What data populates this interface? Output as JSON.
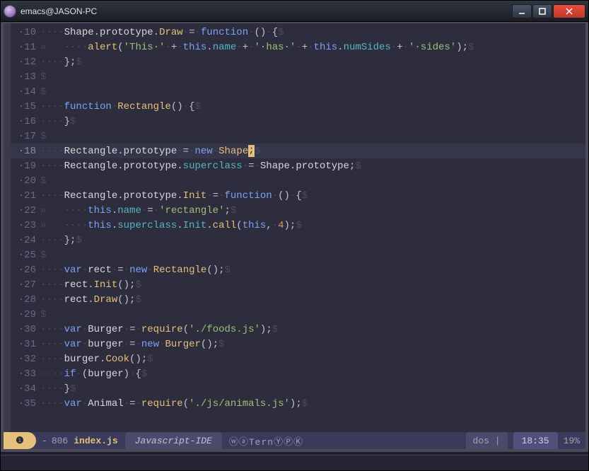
{
  "window": {
    "title": "emacs@JASON-PC"
  },
  "lines": [
    {
      "n": "10",
      "tokens": [
        {
          "c": "ws",
          "t": "····"
        },
        {
          "c": "id",
          "t": "Shape"
        },
        {
          "c": "punc",
          "t": "."
        },
        {
          "c": "id",
          "t": "prototype"
        },
        {
          "c": "punc",
          "t": "."
        },
        {
          "c": "fn",
          "t": "Draw"
        },
        {
          "c": "ws",
          "t": "·"
        },
        {
          "c": "op",
          "t": "="
        },
        {
          "c": "ws",
          "t": "·"
        },
        {
          "c": "kw",
          "t": "function"
        },
        {
          "c": "ws",
          "t": "·"
        },
        {
          "c": "punc",
          "t": "()"
        },
        {
          "c": "ws",
          "t": "·"
        },
        {
          "c": "punc",
          "t": "{"
        },
        {
          "c": "eol",
          "t": "$"
        }
      ]
    },
    {
      "n": "11",
      "tokens": [
        {
          "c": "tab",
          "t": "»   "
        },
        {
          "c": "ws",
          "t": "····"
        },
        {
          "c": "fn",
          "t": "alert"
        },
        {
          "c": "punc",
          "t": "("
        },
        {
          "c": "str",
          "t": "'This·'"
        },
        {
          "c": "ws",
          "t": "·"
        },
        {
          "c": "op",
          "t": "+"
        },
        {
          "c": "ws",
          "t": "·"
        },
        {
          "c": "kw",
          "t": "this"
        },
        {
          "c": "punc",
          "t": "."
        },
        {
          "c": "prop",
          "t": "name"
        },
        {
          "c": "ws",
          "t": "·"
        },
        {
          "c": "op",
          "t": "+"
        },
        {
          "c": "ws",
          "t": "·"
        },
        {
          "c": "str",
          "t": "'·has·'"
        },
        {
          "c": "ws",
          "t": "·"
        },
        {
          "c": "op",
          "t": "+"
        },
        {
          "c": "ws",
          "t": "·"
        },
        {
          "c": "kw",
          "t": "this"
        },
        {
          "c": "punc",
          "t": "."
        },
        {
          "c": "prop",
          "t": "numSides"
        },
        {
          "c": "ws",
          "t": "·"
        },
        {
          "c": "op",
          "t": "+"
        },
        {
          "c": "ws",
          "t": "·"
        },
        {
          "c": "str",
          "t": "'·sides'"
        },
        {
          "c": "punc",
          "t": ");"
        },
        {
          "c": "eol",
          "t": "$"
        }
      ]
    },
    {
      "n": "12",
      "tokens": [
        {
          "c": "ws",
          "t": "····"
        },
        {
          "c": "punc",
          "t": "};"
        },
        {
          "c": "eol",
          "t": "$"
        }
      ]
    },
    {
      "n": "13",
      "tokens": [
        {
          "c": "eol",
          "t": "$"
        }
      ]
    },
    {
      "n": "14",
      "tokens": [
        {
          "c": "eol",
          "t": "$"
        }
      ]
    },
    {
      "n": "15",
      "tokens": [
        {
          "c": "ws",
          "t": "····"
        },
        {
          "c": "kw",
          "t": "function"
        },
        {
          "c": "ws",
          "t": "·"
        },
        {
          "c": "fn",
          "t": "Rectangle"
        },
        {
          "c": "punc",
          "t": "()"
        },
        {
          "c": "ws",
          "t": "·"
        },
        {
          "c": "punc",
          "t": "{"
        },
        {
          "c": "eol",
          "t": "$"
        }
      ]
    },
    {
      "n": "16",
      "tokens": [
        {
          "c": "ws",
          "t": "····"
        },
        {
          "c": "punc",
          "t": "}"
        },
        {
          "c": "eol",
          "t": "$"
        }
      ]
    },
    {
      "n": "17",
      "tokens": [
        {
          "c": "eol",
          "t": "$"
        }
      ]
    },
    {
      "n": "18",
      "current": true,
      "tokens": [
        {
          "c": "ws",
          "t": "····"
        },
        {
          "c": "id",
          "t": "Rectangle"
        },
        {
          "c": "punc",
          "t": "."
        },
        {
          "c": "id",
          "t": "prototype"
        },
        {
          "c": "ws",
          "t": "·"
        },
        {
          "c": "op",
          "t": "="
        },
        {
          "c": "ws",
          "t": "·"
        },
        {
          "c": "kw",
          "t": "new"
        },
        {
          "c": "ws",
          "t": "·"
        },
        {
          "c": "fn",
          "t": "Shape"
        },
        {
          "c": "cursor",
          "t": ";"
        },
        {
          "c": "eol",
          "t": "$"
        }
      ]
    },
    {
      "n": "19",
      "tokens": [
        {
          "c": "ws",
          "t": "····"
        },
        {
          "c": "id",
          "t": "Rectangle"
        },
        {
          "c": "punc",
          "t": "."
        },
        {
          "c": "id",
          "t": "prototype"
        },
        {
          "c": "punc",
          "t": "."
        },
        {
          "c": "prop",
          "t": "superclass"
        },
        {
          "c": "ws",
          "t": "·"
        },
        {
          "c": "op",
          "t": "="
        },
        {
          "c": "ws",
          "t": "·"
        },
        {
          "c": "id",
          "t": "Shape"
        },
        {
          "c": "punc",
          "t": "."
        },
        {
          "c": "id",
          "t": "prototype"
        },
        {
          "c": "punc",
          "t": ";"
        },
        {
          "c": "eol",
          "t": "$"
        }
      ]
    },
    {
      "n": "20",
      "tokens": [
        {
          "c": "eol",
          "t": "$"
        }
      ]
    },
    {
      "n": "21",
      "tokens": [
        {
          "c": "ws",
          "t": "····"
        },
        {
          "c": "id",
          "t": "Rectangle"
        },
        {
          "c": "punc",
          "t": "."
        },
        {
          "c": "id",
          "t": "prototype"
        },
        {
          "c": "punc",
          "t": "."
        },
        {
          "c": "fn",
          "t": "Init"
        },
        {
          "c": "ws",
          "t": "·"
        },
        {
          "c": "op",
          "t": "="
        },
        {
          "c": "ws",
          "t": "·"
        },
        {
          "c": "kw",
          "t": "function"
        },
        {
          "c": "ws",
          "t": "·"
        },
        {
          "c": "punc",
          "t": "()"
        },
        {
          "c": "ws",
          "t": "·"
        },
        {
          "c": "punc",
          "t": "{"
        },
        {
          "c": "eol",
          "t": "$"
        }
      ]
    },
    {
      "n": "22",
      "tokens": [
        {
          "c": "tab",
          "t": "»   "
        },
        {
          "c": "ws",
          "t": "····"
        },
        {
          "c": "kw",
          "t": "this"
        },
        {
          "c": "punc",
          "t": "."
        },
        {
          "c": "prop",
          "t": "name"
        },
        {
          "c": "ws",
          "t": "·"
        },
        {
          "c": "op",
          "t": "="
        },
        {
          "c": "ws",
          "t": "·"
        },
        {
          "c": "str",
          "t": "'rectangle'"
        },
        {
          "c": "punc",
          "t": ";"
        },
        {
          "c": "eol",
          "t": "$"
        }
      ]
    },
    {
      "n": "23",
      "tokens": [
        {
          "c": "tab",
          "t": "»   "
        },
        {
          "c": "ws",
          "t": "····"
        },
        {
          "c": "kw",
          "t": "this"
        },
        {
          "c": "punc",
          "t": "."
        },
        {
          "c": "prop",
          "t": "superclass"
        },
        {
          "c": "punc",
          "t": "."
        },
        {
          "c": "prop",
          "t": "Init"
        },
        {
          "c": "punc",
          "t": "."
        },
        {
          "c": "fn",
          "t": "call"
        },
        {
          "c": "punc",
          "t": "("
        },
        {
          "c": "kw",
          "t": "this"
        },
        {
          "c": "punc",
          "t": ","
        },
        {
          "c": "ws",
          "t": "·"
        },
        {
          "c": "num",
          "t": "4"
        },
        {
          "c": "punc",
          "t": ");"
        },
        {
          "c": "eol",
          "t": "$"
        }
      ]
    },
    {
      "n": "24",
      "tokens": [
        {
          "c": "ws",
          "t": "····"
        },
        {
          "c": "punc",
          "t": "};"
        },
        {
          "c": "eol",
          "t": "$"
        }
      ]
    },
    {
      "n": "25",
      "tokens": [
        {
          "c": "eol",
          "t": "$"
        }
      ]
    },
    {
      "n": "26",
      "tokens": [
        {
          "c": "ws",
          "t": "····"
        },
        {
          "c": "kw",
          "t": "var"
        },
        {
          "c": "ws",
          "t": "·"
        },
        {
          "c": "id",
          "t": "rect"
        },
        {
          "c": "ws",
          "t": "·"
        },
        {
          "c": "op",
          "t": "="
        },
        {
          "c": "ws",
          "t": "·"
        },
        {
          "c": "kw",
          "t": "new"
        },
        {
          "c": "ws",
          "t": "·"
        },
        {
          "c": "fn",
          "t": "Rectangle"
        },
        {
          "c": "punc",
          "t": "();"
        },
        {
          "c": "eol",
          "t": "$"
        }
      ]
    },
    {
      "n": "27",
      "tokens": [
        {
          "c": "ws",
          "t": "····"
        },
        {
          "c": "id",
          "t": "rect"
        },
        {
          "c": "punc",
          "t": "."
        },
        {
          "c": "fn",
          "t": "Init"
        },
        {
          "c": "punc",
          "t": "();"
        },
        {
          "c": "eol",
          "t": "$"
        }
      ]
    },
    {
      "n": "28",
      "tokens": [
        {
          "c": "ws",
          "t": "····"
        },
        {
          "c": "id",
          "t": "rect"
        },
        {
          "c": "punc",
          "t": "."
        },
        {
          "c": "fn",
          "t": "Draw"
        },
        {
          "c": "punc",
          "t": "();"
        },
        {
          "c": "eol",
          "t": "$"
        }
      ]
    },
    {
      "n": "29",
      "tokens": [
        {
          "c": "eol",
          "t": "$"
        }
      ]
    },
    {
      "n": "30",
      "tokens": [
        {
          "c": "ws",
          "t": "····"
        },
        {
          "c": "kw",
          "t": "var"
        },
        {
          "c": "ws",
          "t": "·"
        },
        {
          "c": "id",
          "t": "Burger"
        },
        {
          "c": "ws",
          "t": "·"
        },
        {
          "c": "op",
          "t": "="
        },
        {
          "c": "ws",
          "t": "·"
        },
        {
          "c": "fn",
          "t": "require"
        },
        {
          "c": "punc",
          "t": "("
        },
        {
          "c": "str",
          "t": "'./foods.js'"
        },
        {
          "c": "punc",
          "t": ");"
        },
        {
          "c": "eol",
          "t": "$"
        }
      ]
    },
    {
      "n": "31",
      "tokens": [
        {
          "c": "ws",
          "t": "····"
        },
        {
          "c": "kw",
          "t": "var"
        },
        {
          "c": "ws",
          "t": "·"
        },
        {
          "c": "id",
          "t": "burger"
        },
        {
          "c": "ws",
          "t": "·"
        },
        {
          "c": "op",
          "t": "="
        },
        {
          "c": "ws",
          "t": "·"
        },
        {
          "c": "kw",
          "t": "new"
        },
        {
          "c": "ws",
          "t": "·"
        },
        {
          "c": "fn",
          "t": "Burger"
        },
        {
          "c": "punc",
          "t": "();"
        },
        {
          "c": "eol",
          "t": "$"
        }
      ]
    },
    {
      "n": "32",
      "tokens": [
        {
          "c": "ws",
          "t": "····"
        },
        {
          "c": "id",
          "t": "burger"
        },
        {
          "c": "punc",
          "t": "."
        },
        {
          "c": "fn",
          "t": "Cook"
        },
        {
          "c": "punc",
          "t": "();"
        },
        {
          "c": "eol",
          "t": "$"
        }
      ]
    },
    {
      "n": "33",
      "tokens": [
        {
          "c": "ws",
          "t": "····"
        },
        {
          "c": "kw",
          "t": "if"
        },
        {
          "c": "ws",
          "t": "·"
        },
        {
          "c": "punc",
          "t": "("
        },
        {
          "c": "id",
          "t": "burger"
        },
        {
          "c": "punc",
          "t": ")"
        },
        {
          "c": "ws",
          "t": "·"
        },
        {
          "c": "punc",
          "t": "{"
        },
        {
          "c": "eol",
          "t": "$"
        }
      ]
    },
    {
      "n": "34",
      "tokens": [
        {
          "c": "ws",
          "t": "····"
        },
        {
          "c": "punc",
          "t": "}"
        },
        {
          "c": "eol",
          "t": "$"
        }
      ]
    },
    {
      "n": "35",
      "tokens": [
        {
          "c": "ws",
          "t": "····"
        },
        {
          "c": "kw",
          "t": "var"
        },
        {
          "c": "ws",
          "t": "·"
        },
        {
          "c": "id",
          "t": "Animal"
        },
        {
          "c": "ws",
          "t": "·"
        },
        {
          "c": "op",
          "t": "="
        },
        {
          "c": "ws",
          "t": "·"
        },
        {
          "c": "fn",
          "t": "require"
        },
        {
          "c": "punc",
          "t": "("
        },
        {
          "c": "str",
          "t": "'./js/animals.js'"
        },
        {
          "c": "punc",
          "t": ");"
        },
        {
          "c": "eol",
          "t": "$"
        }
      ]
    }
  ],
  "modeline": {
    "badge": "❶",
    "modified": "-",
    "size": "806",
    "buffer": "index.js",
    "major": "Javascript-IDE",
    "minor": "ⓦⓐTernⓎⓅⓀ",
    "encoding": "dos",
    "sep": "|",
    "position": "18:35",
    "percent": "19%"
  }
}
